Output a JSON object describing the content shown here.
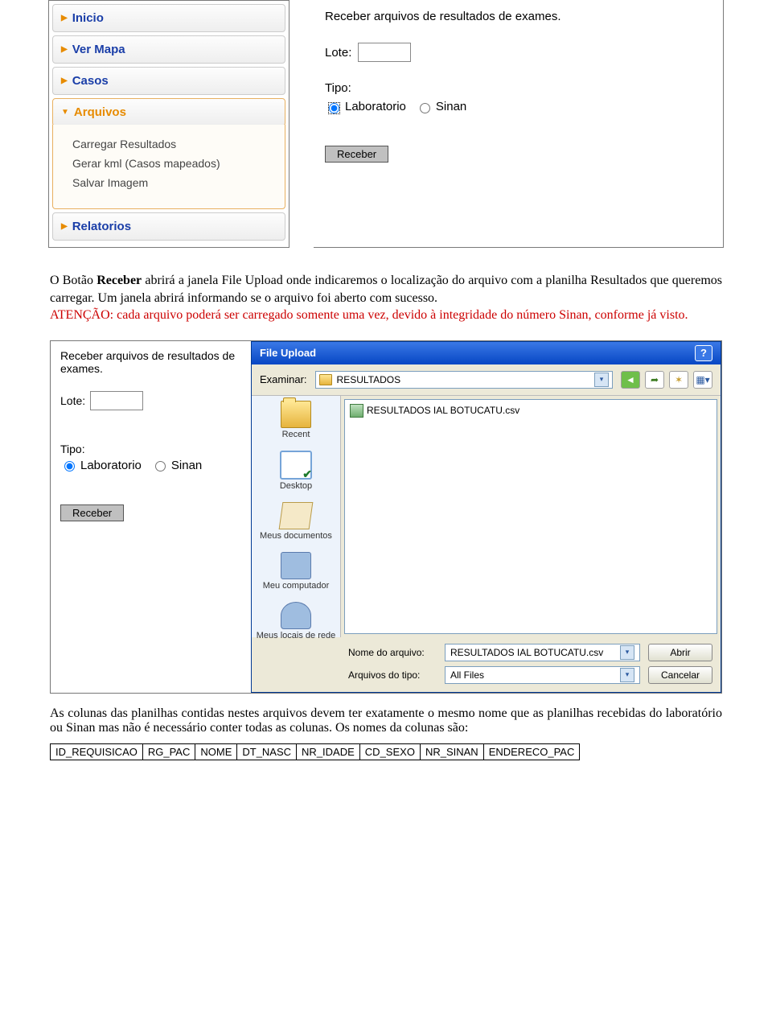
{
  "sidebar": {
    "items": [
      "Inicio",
      "Ver Mapa",
      "Casos",
      "Arquivos",
      "Relatorios"
    ],
    "active_index": 3,
    "sub": [
      "Carregar Resultados",
      "Gerar kml (Casos mapeados)",
      "Salvar Imagem"
    ]
  },
  "form": {
    "heading": "Receber arquivos de resultados de exames.",
    "lote_label": "Lote:",
    "tipo_label": "Tipo:",
    "radio1": "Laboratorio",
    "radio2": "Sinan",
    "button": "Receber"
  },
  "para1_pre": "O Botão ",
  "para1_bold": "Receber",
  "para1_post": " abrirá a janela File Upload onde indicaremos o localização do arquivo com a planilha Resultados que queremos carregar. Um janela abrirá informando se o arquivo foi aberto com sucesso.",
  "para1_red": "ATENÇÃO: cada arquivo poderá ser carregado somente uma vez, devido à integridade do número Sinan, conforme já visto.",
  "dialog": {
    "title": "File Upload",
    "examinar_label": "Examinar:",
    "folder": "RESULTADOS",
    "file": "RESULTADOS IAL BOTUCATU.csv",
    "places": [
      "Recent",
      "Desktop",
      "Meus documentos",
      "Meu computador",
      "Meus locais de rede"
    ],
    "filename_label": "Nome do arquivo:",
    "filename_value": "RESULTADOS IAL BOTUCATU.csv",
    "filetype_label": "Arquivos do tipo:",
    "filetype_value": "All Files",
    "open": "Abrir",
    "cancel": "Cancelar"
  },
  "para2": "As colunas das planilhas contidas nestes arquivos devem ter exatamente o mesmo nome que as planilhas recebidas do laboratório ou Sinan mas não é necessário conter todas as colunas. Os nomes da colunas são:",
  "columns": [
    "ID_REQUISICAO",
    "RG_PAC",
    "NOME",
    "DT_NASC",
    "NR_IDADE",
    "CD_SEXO",
    "NR_SINAN",
    "ENDERECO_PAC"
  ]
}
